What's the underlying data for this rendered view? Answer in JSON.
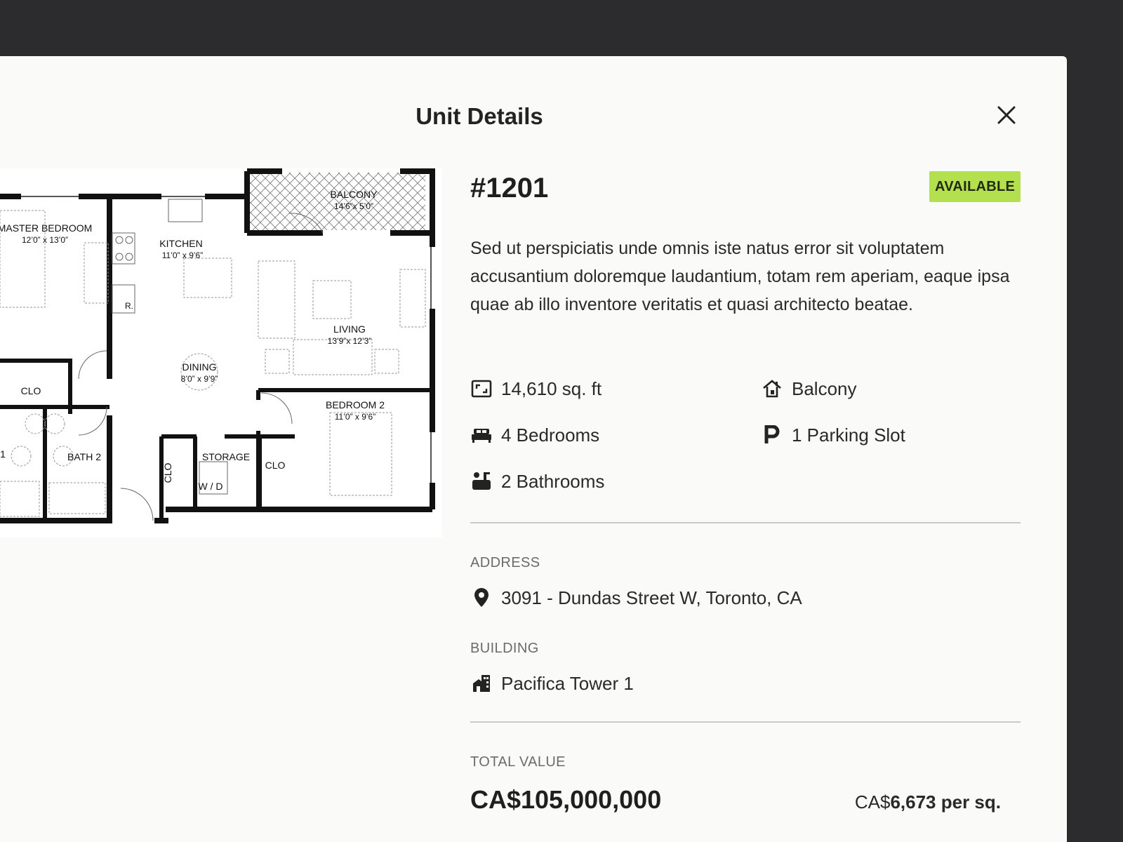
{
  "modal": {
    "title": "Unit Details"
  },
  "floorplan": {
    "rooms": [
      {
        "name": "MASTER BEDROOM",
        "size": "12’0” x 13’0”"
      },
      {
        "name": "KITCHEN",
        "size": "11’0” x 9’6”"
      },
      {
        "name": "BALCONY",
        "size": "14’6”x 5’0”"
      },
      {
        "name": "LIVING",
        "size": "13’9”x 12’3”"
      },
      {
        "name": "DINING",
        "size": "8’0” x 9’9”"
      },
      {
        "name": "BEDROOM 2",
        "size": "11’0” x 9’6”"
      }
    ],
    "labels": {
      "clo_left": "CLO",
      "bath2": "BATH 2",
      "clo_vertical": "CLO",
      "storage": "STORAGE",
      "wd": "W / D",
      "clo_right": "CLO",
      "fridge": "R.",
      "bath1_partial": "1"
    }
  },
  "unit": {
    "number": "#1201",
    "status": "AVAILABLE",
    "status_color": "#b4e050",
    "description": "Sed ut perspiciatis unde omnis iste natus error sit voluptatem accusantium doloremque laudantium, totam rem aperiam, eaque ipsa quae ab illo inventore veritatis et quasi architecto beatae."
  },
  "features": [
    {
      "icon": "area-icon",
      "label": "14,610 sq. ft"
    },
    {
      "icon": "balcony-icon",
      "label": "Balcony"
    },
    {
      "icon": "bed-icon",
      "label": "4 Bedrooms"
    },
    {
      "icon": "parking-icon",
      "label": "1 Parking Slot"
    },
    {
      "icon": "bath-icon",
      "label": "2 Bathrooms"
    }
  ],
  "address": {
    "label": "ADDRESS",
    "icon": "location-pin-icon",
    "value": "3091 - Dundas Street W, Toronto, CA"
  },
  "building": {
    "label": "BUILDING",
    "icon": "building-icon",
    "value": "Pacifica Tower 1"
  },
  "pricing": {
    "label": "TOTAL VALUE",
    "total": "CA$105,000,000",
    "per_sq_prefix": "CA$",
    "per_sq_amount": "6,673 per sq."
  }
}
